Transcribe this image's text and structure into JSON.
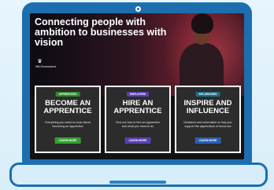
{
  "hero": {
    "title": "Connecting people with\nambition to businesses with\nvision",
    "gov_label": "HM Government"
  },
  "cards": [
    {
      "tag": "APPRENTICES",
      "title": "BECOME AN\nAPPRENTICE",
      "description": "Everything you need to know about\nbecoming an apprentice",
      "button": "LEARN MORE"
    },
    {
      "tag": "EMPLOYERS",
      "title": "HIRE AN\nAPPRENTICE",
      "description": "Find out how to hire an apprentice\nand what you need to do",
      "button": "LEARN MORE"
    },
    {
      "tag": "INFLUENCERS",
      "title": "INSPIRE AND\nINFLUENCE",
      "description": "Guidance and information to help you\nsupport the apprentices of tomorrow",
      "button": "LEARN MORE"
    }
  ],
  "colors": {
    "laptop": "#1d6eaf",
    "background": "#e1f1fb",
    "card_bg": "#2c2c2c",
    "tag_green": "#2e8b2e",
    "tag_purple": "#5a3fb0",
    "tag_teal": "#1e6f8a"
  }
}
